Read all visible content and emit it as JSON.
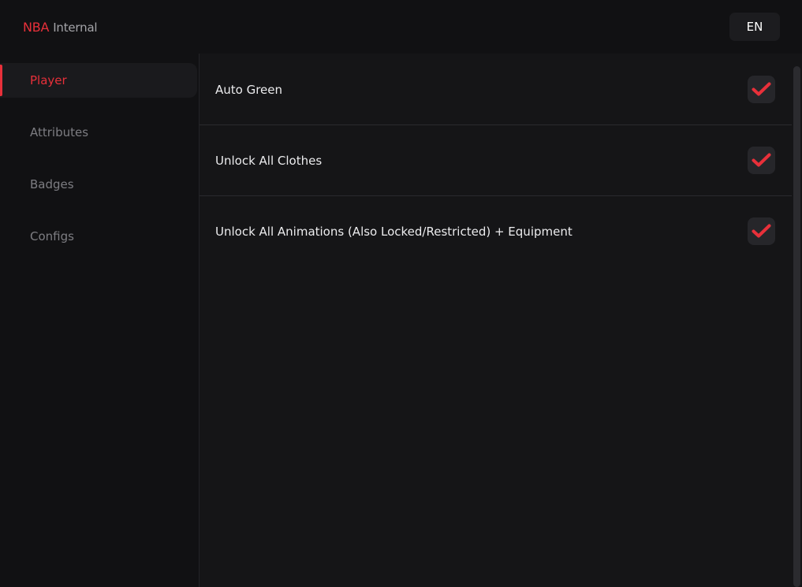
{
  "header": {
    "brand_accent": "NBA",
    "brand_rest": "Internal",
    "language": "EN"
  },
  "sidebar": {
    "items": [
      {
        "label": "Player",
        "active": true
      },
      {
        "label": "Attributes",
        "active": false
      },
      {
        "label": "Badges",
        "active": false
      },
      {
        "label": "Configs",
        "active": false
      }
    ]
  },
  "main": {
    "options": [
      {
        "label": "Auto Green",
        "checked": true
      },
      {
        "label": "Unlock All Clothes",
        "checked": true
      },
      {
        "label": "Unlock All Animations (Also Locked/Restricted) + Equipment",
        "checked": true
      }
    ]
  },
  "colors": {
    "accent": "#e8303a",
    "background": "#151517",
    "sidebar": "#111113"
  },
  "icons": {
    "checkbox": "checkmark-icon"
  }
}
